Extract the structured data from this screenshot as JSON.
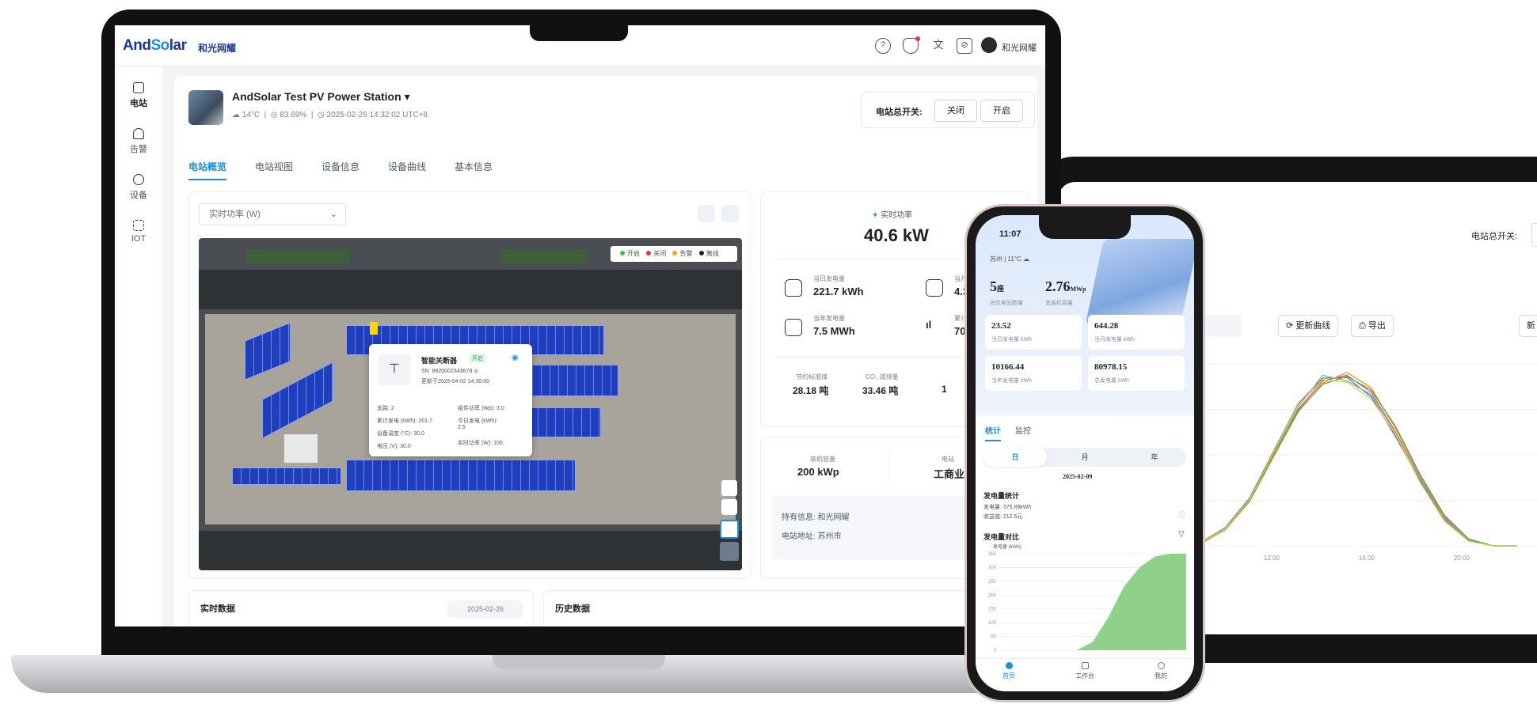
{
  "brand": {
    "logo_and": "And",
    "logo_so": "So",
    "logo_lar": "lar",
    "logo_cn": "和光网耀"
  },
  "header": {
    "user_name": "和光网耀",
    "icons": [
      "help-icon",
      "bell-icon",
      "translate-icon",
      "theme-icon",
      "avatar"
    ]
  },
  "sidebar": {
    "items": [
      {
        "label": "电站",
        "active": true
      },
      {
        "label": "告警"
      },
      {
        "label": "设备"
      },
      {
        "label": "IOT"
      }
    ]
  },
  "station": {
    "title": "AndSolar Test PV Power Station",
    "temperature": "14°C",
    "humidity": "83.69%",
    "datetime": "2025-02-26 14:32:02 UTC+8",
    "switch_label": "电站总开关:",
    "off_label": "关闭",
    "on_label": "开启"
  },
  "tabs": [
    {
      "label": "电站概览",
      "active": true
    },
    {
      "label": "电站视图"
    },
    {
      "label": "设备信息"
    },
    {
      "label": "设备曲线"
    },
    {
      "label": "基本信息"
    }
  ],
  "map_panel": {
    "select_value": "实时功率 (W)",
    "legend": [
      "开启",
      "关闭",
      "告警",
      "离线"
    ],
    "legend_colors": [
      "#2ecc40",
      "#e53935",
      "#f5a623",
      "#222222"
    ],
    "popup": {
      "title": "智能关断器",
      "tag": "开启",
      "sn": "SN: 8820002343678 ◎",
      "updated": "更新于2025-04-02 14:30:00",
      "rows": [
        "支路: 2",
        "组件功率 (Wp): 3.0",
        "累计发电 (kWh): 201.7",
        "今日发电 (kWh):",
        "2.5",
        "设备温度 (°C): 30.0",
        "电压 (V): 30.0",
        "实时功率 (W): 100"
      ]
    }
  },
  "kpi": {
    "realtime_label": "实时功率",
    "realtime_value": "40.6 kW",
    "items": [
      {
        "label": "当日发电量",
        "value": "221.7 kWh"
      },
      {
        "label": "当月发",
        "value": "4.3 M"
      },
      {
        "label": "当年发电量",
        "value": "7.5 MWh"
      },
      {
        "label": "累计发",
        "value": "70.4"
      }
    ],
    "savings": [
      {
        "label": "节约标准煤",
        "value": "28.18 吨"
      },
      {
        "label": "CO₂ 减排量",
        "value": "33.46 吨"
      },
      {
        "label": "",
        "value": "1"
      }
    ]
  },
  "info": {
    "capacity_label": "装机容量",
    "capacity_value": "200 kWp",
    "type_label": "电站",
    "type_value": "工商业",
    "owner": "持有信息: 和光网耀",
    "address": "电站地址: 苏州市"
  },
  "bottom": {
    "realtime_data": "实时数据",
    "date_value": "2025-02-26",
    "history_data": "历史数据"
  },
  "phone": {
    "time": "11:07",
    "weather": "苏州 | 11°C",
    "count_value": "5",
    "count_unit": "座",
    "count_label": "光伏电站数量",
    "capacity_value": "2.76",
    "capacity_unit": "MWp",
    "capacity_label": "总装机容量",
    "tiles": [
      {
        "value": "23.52",
        "label": "当日发电量 kWh"
      },
      {
        "value": "644.28",
        "label": "当月发电量 kWh"
      },
      {
        "value": "10166.44",
        "label": "当年发电量 kWh"
      },
      {
        "value": "80978.15",
        "label": "总发电量 kWh"
      }
    ],
    "tabs": [
      "统计",
      "监控"
    ],
    "segments": [
      "日",
      "月",
      "年"
    ],
    "date": "2025-02-09",
    "stats_title": "发电量统计",
    "stats_gen": "发电量: 375.89kWh",
    "stats_income": "收益值: 212.5元",
    "compare_title": "发电量对比",
    "compare_unit": "发电量 (kWh)",
    "y_ticks": [
      "350",
      "300",
      "250",
      "200",
      "150",
      "100",
      "50",
      "0"
    ],
    "tabbar": [
      "首页",
      "工作台",
      "我的"
    ]
  },
  "tablet": {
    "switch_label": "电站总开关:",
    "refresh_label": "更新曲线",
    "export_label": "导出",
    "new_label": "新",
    "x_ticks": [
      "8:00",
      "12:00",
      "16:00",
      "20:00"
    ],
    "series_colors": [
      "#e15759",
      "#4e79a7",
      "#f28e2b",
      "#76b7b2",
      "#59a14f",
      "#edc948",
      "#b07aa1",
      "#ff9da7",
      "#9c755f",
      "#8cd17d",
      "#499894",
      "#d37295"
    ]
  },
  "chart_data": [
    {
      "type": "area",
      "x": [
        "0",
        "2",
        "4",
        "6",
        "8",
        "10",
        "12",
        "14",
        "16",
        "18",
        "20",
        "22",
        "24"
      ],
      "series": [
        {
          "values": [
            0,
            0,
            0,
            0,
            0,
            0,
            30,
            120,
            230,
            300,
            340,
            350,
            350
          ]
        }
      ],
      "ylim": [
        0,
        350
      ],
      "ylabel": "发电量 (kWh)"
    },
    {
      "type": "line",
      "x": [
        "6:00",
        "7:00",
        "8:00",
        "9:00",
        "10:00",
        "11:00",
        "12:00",
        "13:00",
        "14:00",
        "15:00",
        "16:00",
        "17:00",
        "18:00",
        "19:00",
        "20:00"
      ],
      "series": [
        {
          "values": [
            0,
            5,
            30,
            80,
            160,
            240,
            290,
            300,
            270,
            200,
            120,
            50,
            10,
            0,
            0
          ]
        },
        {
          "values": [
            0,
            6,
            32,
            84,
            168,
            250,
            295,
            296,
            262,
            192,
            115,
            46,
            9,
            0,
            0
          ]
        },
        {
          "values": [
            0,
            4,
            28,
            78,
            158,
            236,
            286,
            305,
            278,
            206,
            124,
            52,
            11,
            0,
            0
          ]
        },
        {
          "values": [
            0,
            5,
            29,
            82,
            164,
            244,
            300,
            290,
            266,
            198,
            118,
            48,
            10,
            0,
            0
          ]
        },
        {
          "values": [
            0,
            6,
            31,
            79,
            162,
            238,
            284,
            298,
            274,
            210,
            126,
            54,
            12,
            0,
            0
          ]
        },
        {
          "values": [
            0,
            5,
            30,
            81,
            166,
            248,
            292,
            288,
            258,
            196,
            112,
            44,
            8,
            0,
            0
          ]
        }
      ],
      "ylim": [
        0,
        320
      ]
    }
  ]
}
